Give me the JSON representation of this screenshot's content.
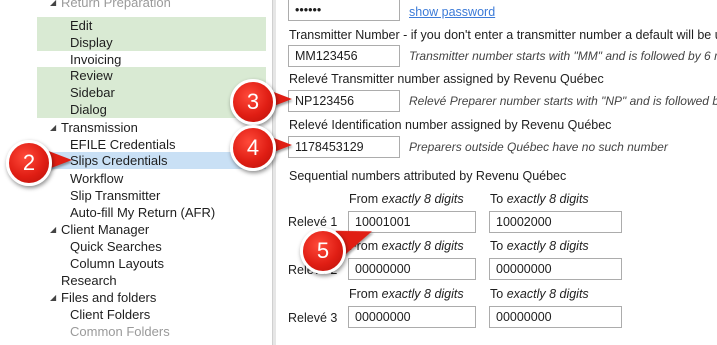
{
  "tree": {
    "items": [
      {
        "label": "Return Preparation",
        "expanded": true
      },
      {
        "label": "Edit"
      },
      {
        "label": "Display"
      },
      {
        "label": "Invoicing"
      },
      {
        "label": "Review"
      },
      {
        "label": "Sidebar"
      },
      {
        "label": "Dialog"
      },
      {
        "label": "Transmission",
        "expanded": true
      },
      {
        "label": "EFILE Credentials"
      },
      {
        "label": "Slips Credentials",
        "selected": true
      },
      {
        "label": "Workflow"
      },
      {
        "label": "Slip Transmitter"
      },
      {
        "label": "Auto-fill My Return (AFR)"
      },
      {
        "label": "Client Manager",
        "expanded": true
      },
      {
        "label": "Quick Searches"
      },
      {
        "label": "Column Layouts"
      },
      {
        "label": "Research"
      },
      {
        "label": "Files and folders",
        "expanded": true
      },
      {
        "label": "Client Folders"
      },
      {
        "label": "Common Folders"
      }
    ]
  },
  "password": {
    "value": "••••••",
    "show_link": "show password"
  },
  "transmitter": {
    "label": "Transmitter Number - if you don't enter a transmitter number a default will be us",
    "value": "MM123456",
    "hint": "Transmitter number starts with \"MM\" and is followed by 6 n"
  },
  "releve_transmitter": {
    "label": "Relevé Transmitter number assigned by Revenu Québec",
    "value": "NP123456",
    "hint": "Relevé Preparer number starts with \"NP\" and is followed by"
  },
  "releve_id": {
    "label": "Relevé Identification number assigned by Revenu Québec",
    "value": "1178453129",
    "hint": "Preparers outside Québec have no such number"
  },
  "sequential": {
    "title": "Sequential numbers attributed by Revenu Québec",
    "from_prefix": "From",
    "to_prefix": "To",
    "digits_hint": "exactly 8 digits",
    "rows": [
      {
        "label": "Relevé 1",
        "from": "10001001",
        "to": "10002000"
      },
      {
        "label": "Relevé 2",
        "from": "00000000",
        "to": "00000000"
      },
      {
        "label": "Relevé 3",
        "from": "00000000",
        "to": "00000000"
      }
    ]
  },
  "callouts": [
    "2",
    "3",
    "4",
    "5"
  ],
  "colors": {
    "highlight_green": "#d9ead3",
    "selection_blue": "#c9e0f5",
    "callout_red": "#e01e14",
    "link_blue": "#3c7bd8"
  }
}
